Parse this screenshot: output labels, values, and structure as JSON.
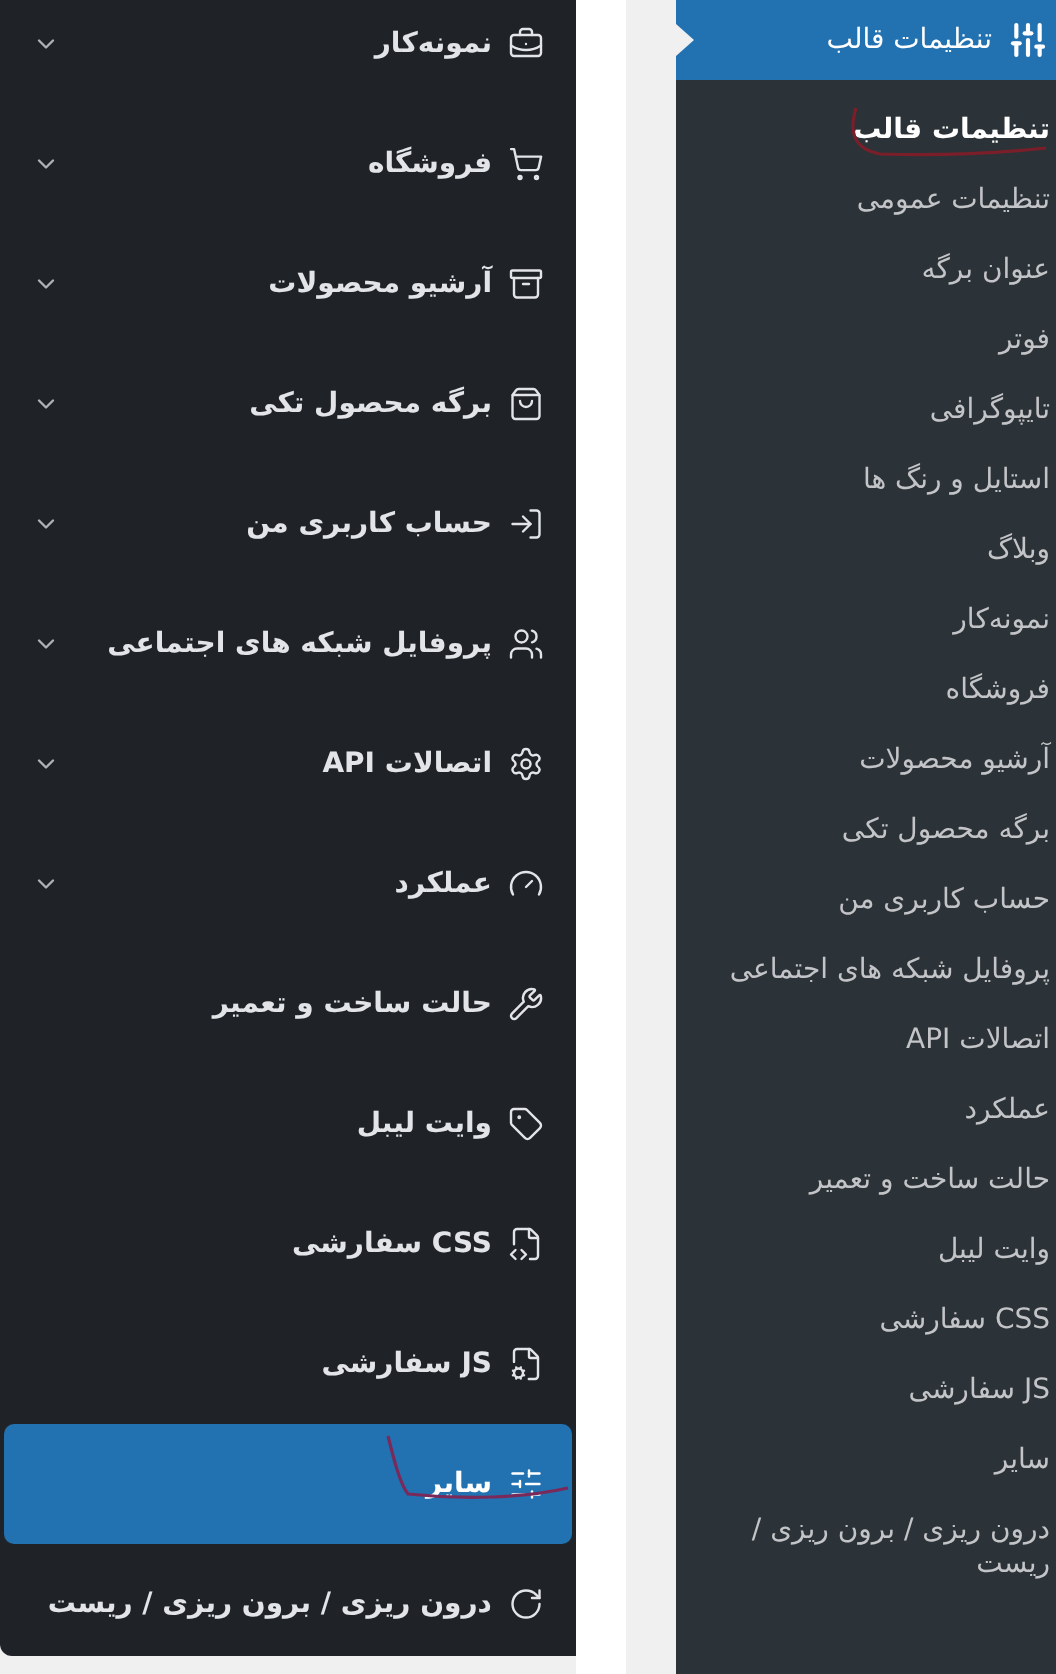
{
  "left_menu": {
    "items": [
      {
        "label": "نمونه‌کار",
        "expandable": true,
        "selected": false
      },
      {
        "label": "فروشگاه",
        "expandable": true,
        "selected": false
      },
      {
        "label": "آرشیو محصولات",
        "expandable": true,
        "selected": false
      },
      {
        "label": "برگه محصول تکی",
        "expandable": true,
        "selected": false
      },
      {
        "label": "حساب کاربری من",
        "expandable": true,
        "selected": false
      },
      {
        "label": "پروفایل شبکه های اجتماعی",
        "expandable": true,
        "selected": false
      },
      {
        "label": "اتصالات API",
        "expandable": true,
        "selected": false
      },
      {
        "label": "عملکرد",
        "expandable": true,
        "selected": false
      },
      {
        "label": "حالت ساخت و تعمیر",
        "expandable": false,
        "selected": false
      },
      {
        "label": "وایت لیبل",
        "expandable": false,
        "selected": false
      },
      {
        "label": "CSS سفارشی",
        "expandable": false,
        "selected": false
      },
      {
        "label": "JS سفارشی",
        "expandable": false,
        "selected": false
      },
      {
        "label": "سایر",
        "expandable": false,
        "selected": true
      },
      {
        "label": "درون ریزی / برون ریزی / ریست",
        "expandable": false,
        "selected": false
      }
    ]
  },
  "admin_menu": {
    "title": "تنظیمات قالب",
    "items": [
      {
        "label": "تنظیمات قالب",
        "selected": true
      },
      {
        "label": "تنظیمات عمومی",
        "selected": false
      },
      {
        "label": "عنوان برگه",
        "selected": false
      },
      {
        "label": "فوتر",
        "selected": false
      },
      {
        "label": "تایپوگرافی",
        "selected": false
      },
      {
        "label": "استایل و رنگ ها",
        "selected": false
      },
      {
        "label": "وبلاگ",
        "selected": false
      },
      {
        "label": "نمونه‌کار",
        "selected": false
      },
      {
        "label": "فروشگاه",
        "selected": false
      },
      {
        "label": "آرشیو محصولات",
        "selected": false
      },
      {
        "label": "برگه محصول تکی",
        "selected": false
      },
      {
        "label": "حساب کاربری من",
        "selected": false
      },
      {
        "label": "پروفایل شبکه های اجتماعی",
        "selected": false
      },
      {
        "label": "اتصالات API",
        "selected": false
      },
      {
        "label": "عملکرد",
        "selected": false
      },
      {
        "label": "حالت ساخت و تعمیر",
        "selected": false
      },
      {
        "label": "وایت لیبل",
        "selected": false
      },
      {
        "label": "CSS سفارشی",
        "selected": false
      },
      {
        "label": "JS سفارشی",
        "selected": false
      },
      {
        "label": "سایر",
        "selected": false
      },
      {
        "label": "درون ریزی / برون ریزی / ریست",
        "selected": false
      }
    ]
  }
}
